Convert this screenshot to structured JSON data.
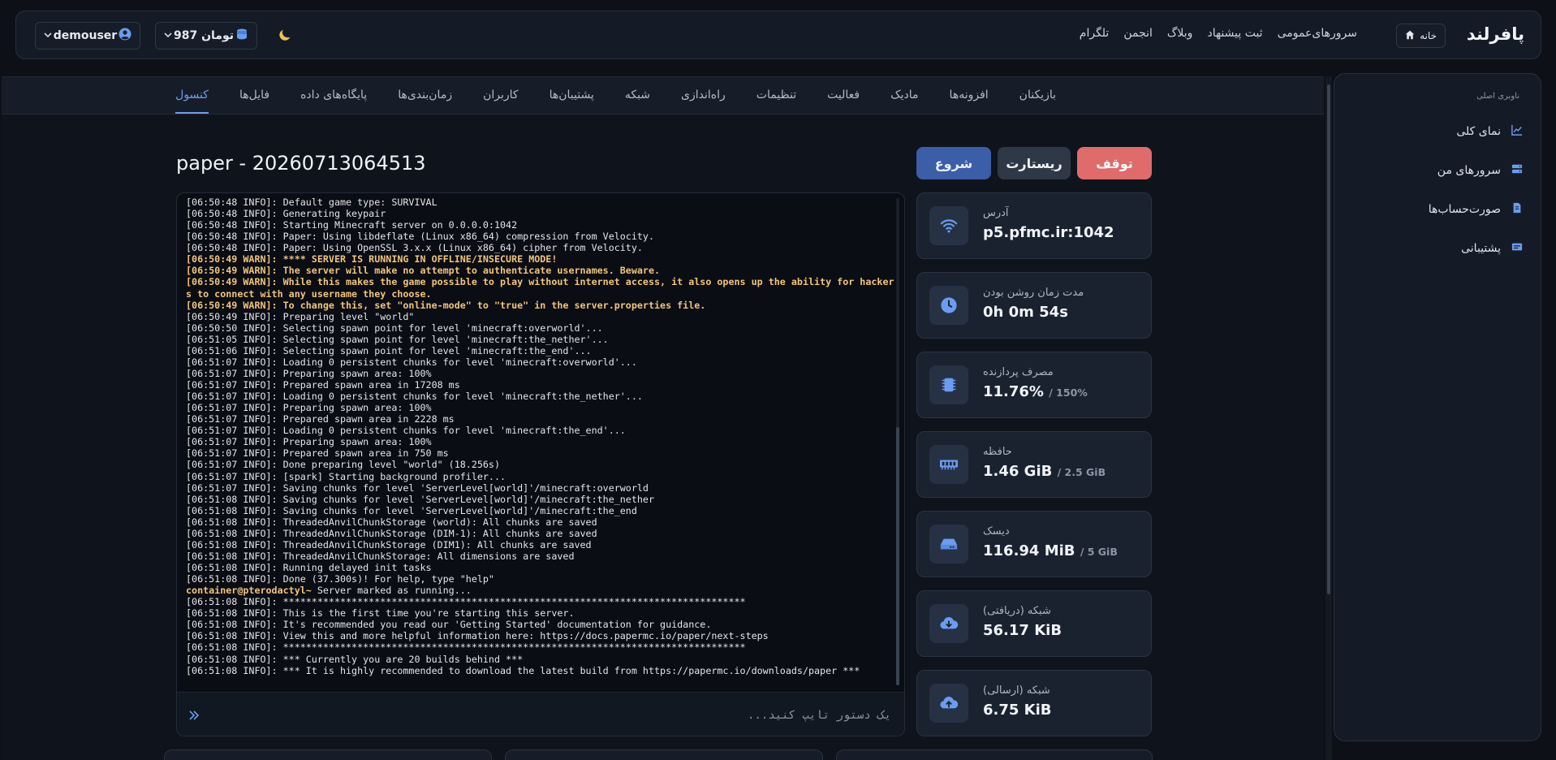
{
  "header": {
    "brand": "پافرلند",
    "home_label": "خانه",
    "nav": [
      "سرورهای‌عمومی",
      "ثبت پیشنهاد",
      "وبلاگ",
      "انجمن",
      "تلگرام"
    ],
    "wallet_label": "987 تومان",
    "username": "demouser"
  },
  "tabs": [
    {
      "label": "بازیکنان",
      "active": false
    },
    {
      "label": "افزونه‌ها",
      "active": false
    },
    {
      "label": "مادیک",
      "active": false
    },
    {
      "label": "فعالیت",
      "active": false
    },
    {
      "label": "تنظیمات",
      "active": false
    },
    {
      "label": "راه‌اندازی",
      "active": false
    },
    {
      "label": "شبکه",
      "active": false
    },
    {
      "label": "پشتیبان‌ها",
      "active": false
    },
    {
      "label": "کاربران",
      "active": false
    },
    {
      "label": "زمان‌بندی‌ها",
      "active": false
    },
    {
      "label": "پایگاه‌های داده",
      "active": false
    },
    {
      "label": "فایل‌ها",
      "active": false
    },
    {
      "label": "کنسول",
      "active": true
    }
  ],
  "server": {
    "title": "paper - 20260713064513",
    "start_label": "شروع",
    "restart_label": "ریستارت",
    "stop_label": "توقف"
  },
  "console": {
    "input_placeholder": "یک دستور تایپ کنید...",
    "lines": [
      {
        "text": "[06:50:48 INFO]: Default game type: SURVIVAL",
        "type": "info"
      },
      {
        "text": "[06:50:48 INFO]: Generating keypair",
        "type": "info"
      },
      {
        "text": "[06:50:48 INFO]: Starting Minecraft server on 0.0.0.0:1042",
        "type": "info"
      },
      {
        "text": "[06:50:48 INFO]: Paper: Using libdeflate (Linux x86_64) compression from Velocity.",
        "type": "info"
      },
      {
        "text": "[06:50:48 INFO]: Paper: Using OpenSSL 3.x.x (Linux x86_64) cipher from Velocity.",
        "type": "info"
      },
      {
        "text": "[06:50:49 WARN]: **** SERVER IS RUNNING IN OFFLINE/INSECURE MODE!",
        "type": "warn"
      },
      {
        "text": "[06:50:49 WARN]: The server will make no attempt to authenticate usernames. Beware.",
        "type": "warn"
      },
      {
        "text": "[06:50:49 WARN]: While this makes the game possible to play without internet access, it also opens up the ability for hackers to connect with any username they choose.",
        "type": "warn"
      },
      {
        "text": "[06:50:49 WARN]: To change this, set \"online-mode\" to \"true\" in the server.properties file.",
        "type": "warn"
      },
      {
        "text": "[06:50:49 INFO]: Preparing level \"world\"",
        "type": "info"
      },
      {
        "text": "[06:50:50 INFO]: Selecting spawn point for level 'minecraft:overworld'...",
        "type": "info"
      },
      {
        "text": "[06:51:05 INFO]: Selecting spawn point for level 'minecraft:the_nether'...",
        "type": "info"
      },
      {
        "text": "[06:51:06 INFO]: Selecting spawn point for level 'minecraft:the_end'...",
        "type": "info"
      },
      {
        "text": "[06:51:07 INFO]: Loading 0 persistent chunks for level 'minecraft:overworld'...",
        "type": "info"
      },
      {
        "text": "[06:51:07 INFO]: Preparing spawn area: 100%",
        "type": "info"
      },
      {
        "text": "[06:51:07 INFO]: Prepared spawn area in 17208 ms",
        "type": "info"
      },
      {
        "text": "[06:51:07 INFO]: Loading 0 persistent chunks for level 'minecraft:the_nether'...",
        "type": "info"
      },
      {
        "text": "[06:51:07 INFO]: Preparing spawn area: 100%",
        "type": "info"
      },
      {
        "text": "[06:51:07 INFO]: Prepared spawn area in 2228 ms",
        "type": "info"
      },
      {
        "text": "[06:51:07 INFO]: Loading 0 persistent chunks for level 'minecraft:the_end'...",
        "type": "info"
      },
      {
        "text": "[06:51:07 INFO]: Preparing spawn area: 100%",
        "type": "info"
      },
      {
        "text": "[06:51:07 INFO]: Prepared spawn area in 750 ms",
        "type": "info"
      },
      {
        "text": "[06:51:07 INFO]: Done preparing level \"world\" (18.256s)",
        "type": "info"
      },
      {
        "text": "[06:51:07 INFO]: [spark] Starting background profiler...",
        "type": "info"
      },
      {
        "text": "[06:51:07 INFO]: Saving chunks for level 'ServerLevel[world]'/minecraft:overworld",
        "type": "info"
      },
      {
        "text": "[06:51:08 INFO]: Saving chunks for level 'ServerLevel[world]'/minecraft:the_nether",
        "type": "info"
      },
      {
        "text": "[06:51:08 INFO]: Saving chunks for level 'ServerLevel[world]'/minecraft:the_end",
        "type": "info"
      },
      {
        "text": "[06:51:08 INFO]: ThreadedAnvilChunkStorage (world): All chunks are saved",
        "type": "info"
      },
      {
        "text": "[06:51:08 INFO]: ThreadedAnvilChunkStorage (DIM-1): All chunks are saved",
        "type": "info"
      },
      {
        "text": "[06:51:08 INFO]: ThreadedAnvilChunkStorage (DIM1): All chunks are saved",
        "type": "info"
      },
      {
        "text": "[06:51:08 INFO]: ThreadedAnvilChunkStorage: All dimensions are saved",
        "type": "info"
      },
      {
        "text": "[06:51:08 INFO]: Running delayed init tasks",
        "type": "info"
      },
      {
        "text": "[06:51:08 INFO]: Done (37.300s)! For help, type \"help\"",
        "type": "info"
      },
      {
        "text": "Server marked as running...",
        "type": "prompt",
        "prompt": "container@pterodactyl~ "
      },
      {
        "text": "[06:51:08 INFO]: *********************************************************************************",
        "type": "info"
      },
      {
        "text": "[06:51:08 INFO]: This is the first time you're starting this server.",
        "type": "info"
      },
      {
        "text": "[06:51:08 INFO]: It's recommended you read our 'Getting Started' documentation for guidance.",
        "type": "info"
      },
      {
        "text": "[06:51:08 INFO]: View this and more helpful information here: https://docs.papermc.io/paper/next-steps",
        "type": "info"
      },
      {
        "text": "[06:51:08 INFO]: *********************************************************************************",
        "type": "info"
      },
      {
        "text": "[06:51:08 INFO]: *** Currently you are 20 builds behind ***",
        "type": "info"
      },
      {
        "text": "[06:51:08 INFO]: *** It is highly recommended to download the latest build from https://papermc.io/downloads/paper ***",
        "type": "info"
      }
    ]
  },
  "stats": [
    {
      "label": "آدرس",
      "value": "p5.pfmc.ir:1042",
      "sub": "",
      "icon": "wifi-icon"
    },
    {
      "label": "مدت زمان روشن بودن",
      "value": "0h 0m 54s",
      "sub": "",
      "icon": "clock-icon"
    },
    {
      "label": "مصرف پردازنده",
      "value": "11.76%",
      "sub": "/ 150%",
      "icon": "cpu-icon"
    },
    {
      "label": "حافظه",
      "value": "1.46 GiB",
      "sub": "/ 2.5 GiB",
      "icon": "memory-icon"
    },
    {
      "label": "دیسک",
      "value": "116.94 MiB",
      "sub": "/ 5 GiB",
      "icon": "disk-icon"
    },
    {
      "label": "شبکه (دریافتی)",
      "value": "56.17 KiB",
      "sub": "",
      "icon": "cloud-download-icon"
    },
    {
      "label": "شبکه (ارسالی)",
      "value": "6.75 KiB",
      "sub": "",
      "icon": "cloud-upload-icon"
    }
  ],
  "sidebar": {
    "heading": "ناوبری اصلی",
    "items": [
      {
        "label": "نمای کلی",
        "icon": "chart-icon"
      },
      {
        "label": "سرورهای من",
        "icon": "server-icon"
      },
      {
        "label": "صورت‌حساب‌ها",
        "icon": "invoice-icon"
      },
      {
        "label": "پشتیبانی",
        "icon": "support-icon"
      }
    ]
  },
  "colors": {
    "accent": "#6c9cf0",
    "warn": "#f2c47a",
    "stop": "#e06b6b",
    "start": "#3c5ea8"
  }
}
